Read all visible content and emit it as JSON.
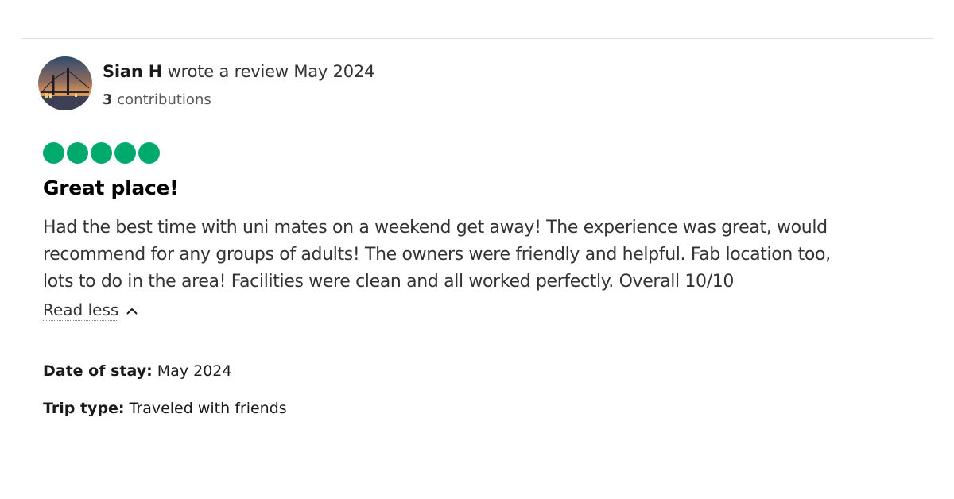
{
  "review": {
    "author": {
      "name": "Sian H",
      "action": "wrote a review",
      "date": "May 2024",
      "contributions_count": "3",
      "contributions_label": "contributions",
      "avatar_icon": "bridge-photo-avatar"
    },
    "rating": {
      "value": 5,
      "max": 5,
      "color": "#00aa6c"
    },
    "title": "Great place!",
    "body_lines": [
      "Had the best time with uni mates on a weekend get away! The experience was great, would",
      "recommend for any groups of adults! The owners were friendly and helpful. Fab location too,",
      "lots to do in the area! Facilities were clean and all worked perfectly. Overall 10/10"
    ],
    "read_less_label": "Read less",
    "read_less_icon": "chevron-up-icon",
    "details": {
      "date_of_stay_label": "Date of stay:",
      "date_of_stay_value": "May 2024",
      "trip_type_label": "Trip type:",
      "trip_type_value": "Traveled with friends"
    }
  }
}
